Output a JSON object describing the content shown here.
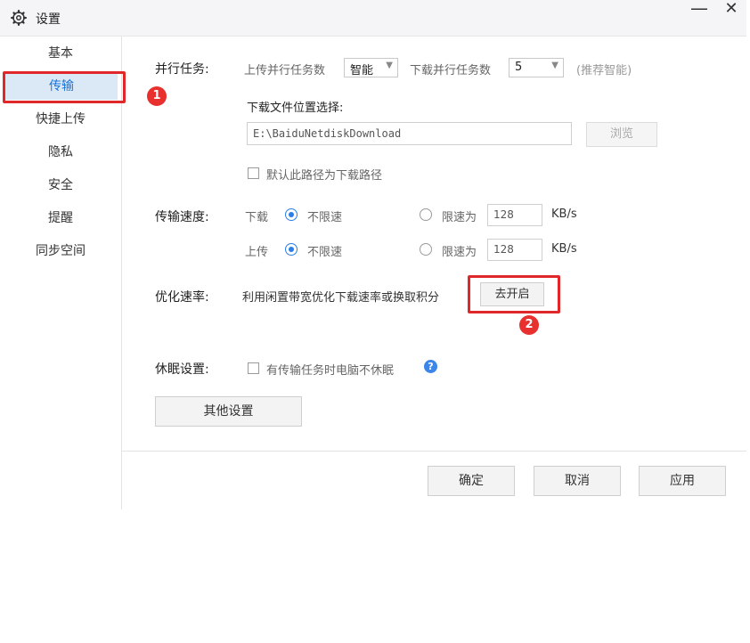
{
  "window": {
    "title": "设置",
    "minimize": "—",
    "close": "✕"
  },
  "sidebar": {
    "items": [
      {
        "label": "基本"
      },
      {
        "label": "传输",
        "active": true
      },
      {
        "label": "快捷上传"
      },
      {
        "label": "隐私"
      },
      {
        "label": "安全"
      },
      {
        "label": "提醒"
      },
      {
        "label": "同步空间"
      }
    ]
  },
  "annotations": {
    "badge1": "1",
    "badge2": "2"
  },
  "parallel": {
    "label": "并行任务:",
    "upload_label": "上传并行任务数",
    "upload_value": "智能",
    "download_label": "下载并行任务数",
    "download_value": "5",
    "hint": "(推荐智能)"
  },
  "download_location": {
    "label": "下载文件位置选择:",
    "path": "E:\\BaiduNetdiskDownload",
    "browse_button": "浏览",
    "default_checkbox_label": "默认此路径为下载路径"
  },
  "speed": {
    "label": "传输速度:",
    "download": {
      "label": "下载",
      "unlimited": "不限速",
      "limit_label": "限速为",
      "limit_value": "128",
      "unit": "KB/s"
    },
    "upload": {
      "label": "上传",
      "unlimited": "不限速",
      "limit_label": "限速为",
      "limit_value": "128",
      "unit": "KB/s"
    }
  },
  "optimize": {
    "label": "优化速率:",
    "desc": "利用闲置带宽优化下载速率或换取积分",
    "button": "去开启"
  },
  "sleep": {
    "label": "休眠设置:",
    "checkbox_label": "有传输任务时电脑不休眠",
    "help": "?"
  },
  "other_settings_button": "其他设置",
  "footer": {
    "ok": "确定",
    "cancel": "取消",
    "apply": "应用"
  },
  "colors": {
    "accent": "#2b7de9",
    "highlight": "#e0282a",
    "active_nav_bg": "#dbe9f7"
  }
}
